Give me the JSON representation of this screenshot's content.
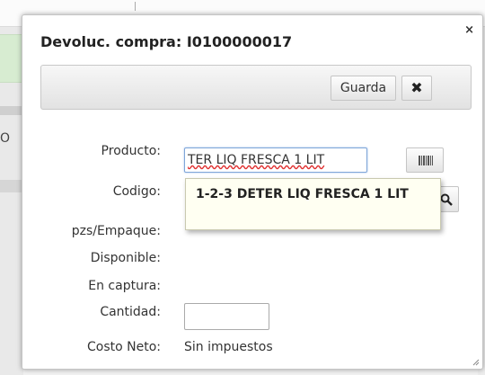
{
  "background": {
    "fragment_text": "O"
  },
  "dialog": {
    "title": "Devoluc. compra: I0100000017",
    "close_label": "×"
  },
  "toolbar": {
    "save_label": "Guarda",
    "cancel_label": "✖"
  },
  "form": {
    "labels": {
      "producto": "Producto:",
      "codigo": "Codigo:",
      "pzs_empaque": "pzs/Empaque:",
      "disponible": "Disponible:",
      "en_captura": "En captura:",
      "cantidad": "Cantidad:",
      "costo_neto": "Costo Neto:"
    },
    "producto_value": "TER LIQ FRESCA 1 LIT",
    "cantidad_value": "",
    "costo_neto_value": "Sin impuestos"
  },
  "autocomplete": {
    "items": [
      {
        "label": "1-2-3 DETER LIQ FRESCA 1 LIT"
      }
    ]
  },
  "icons": {
    "barcode": "barcode-icon",
    "search": "search-icon",
    "close": "close-icon",
    "resize": "resize-grip-icon"
  }
}
